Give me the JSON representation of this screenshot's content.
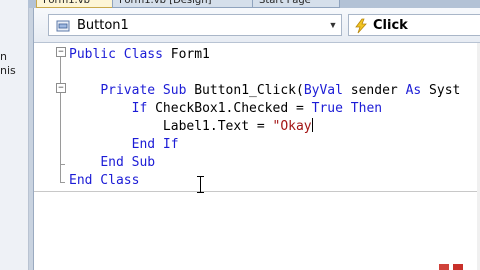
{
  "window": {
    "left_fragments": [
      "n",
      "nis"
    ],
    "tabs": [
      {
        "label": "Form1.vb",
        "active": true
      },
      {
        "label": "Form1.vb [Design]",
        "active": false
      },
      {
        "label": "Start Page",
        "active": false
      }
    ]
  },
  "nav": {
    "object_value": "Button1",
    "event_value": "Click",
    "object_icon": "control-icon",
    "event_icon": "lightning-icon"
  },
  "code": {
    "line1": {
      "kw1": "Public Class",
      "rest": " Form1"
    },
    "line3": {
      "kw1": "Private Sub",
      "mid": " Button1_Click(",
      "kw2": "ByVal",
      "rest": " sender ",
      "kw3": "As",
      "tail": " Syst"
    },
    "line4": {
      "kw1": "If",
      "mid": " CheckBox1.Checked = ",
      "kw2": "True",
      "kw3": " Then"
    },
    "line5": {
      "pre": "Label1.Text = ",
      "str": "\"Okay"
    },
    "line6": {
      "kw1": "End If"
    },
    "line7": {
      "kw1": "End Sub"
    },
    "line8": {
      "kw1": "End Class"
    }
  },
  "colors": {
    "keyword": "#1c1cd6",
    "string": "#a31515",
    "tab_active": "#fdf5d6"
  }
}
